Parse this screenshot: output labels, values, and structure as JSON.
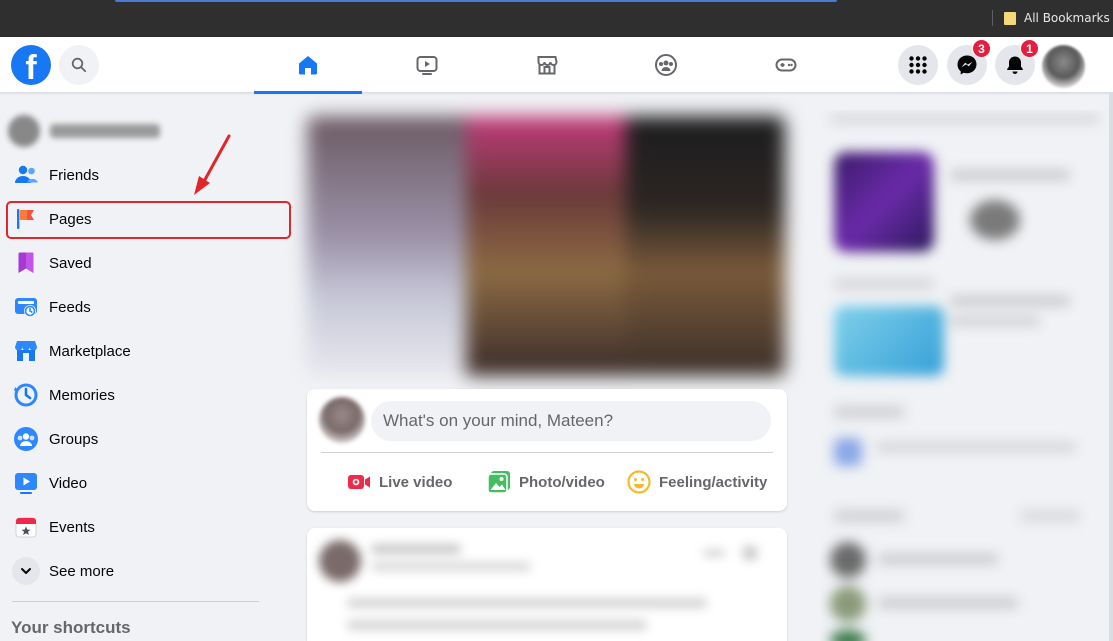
{
  "browser": {
    "bookmarks_label": "All Bookmarks"
  },
  "topnav": {
    "logo_letter": "f",
    "tabs": [
      {
        "name": "home",
        "active": true
      },
      {
        "name": "watch",
        "active": false
      },
      {
        "name": "marketplace",
        "active": false
      },
      {
        "name": "groups",
        "active": false
      },
      {
        "name": "gaming",
        "active": false
      }
    ],
    "messenger_badge": "3",
    "notifications_badge": "1",
    "colors": {
      "brand": "#1877f2",
      "badge": "#e41e3f"
    }
  },
  "sidebar": {
    "items": [
      {
        "label": "Friends",
        "icon": "friends-icon"
      },
      {
        "label": "Pages",
        "icon": "pages-flag-icon"
      },
      {
        "label": "Saved",
        "icon": "saved-bookmark-icon"
      },
      {
        "label": "Feeds",
        "icon": "feeds-icon"
      },
      {
        "label": "Marketplace",
        "icon": "marketplace-icon"
      },
      {
        "label": "Memories",
        "icon": "memories-clock-icon"
      },
      {
        "label": "Groups",
        "icon": "groups-icon"
      },
      {
        "label": "Video",
        "icon": "video-play-icon"
      },
      {
        "label": "Events",
        "icon": "events-calendar-icon"
      },
      {
        "label": "See more",
        "icon": "chevron-down-icon"
      }
    ],
    "shortcuts_title": "Your shortcuts",
    "highlight_color": "#e0262b"
  },
  "composer": {
    "placeholder": "What's on your mind, Mateen?",
    "actions": [
      {
        "label": "Live video",
        "icon": "live-video-icon",
        "color": "#f02849"
      },
      {
        "label": "Photo/video",
        "icon": "photo-video-icon",
        "color": "#45bd62"
      },
      {
        "label": "Feeling/activity",
        "icon": "feeling-smiley-icon",
        "color": "#f7b928"
      }
    ]
  }
}
